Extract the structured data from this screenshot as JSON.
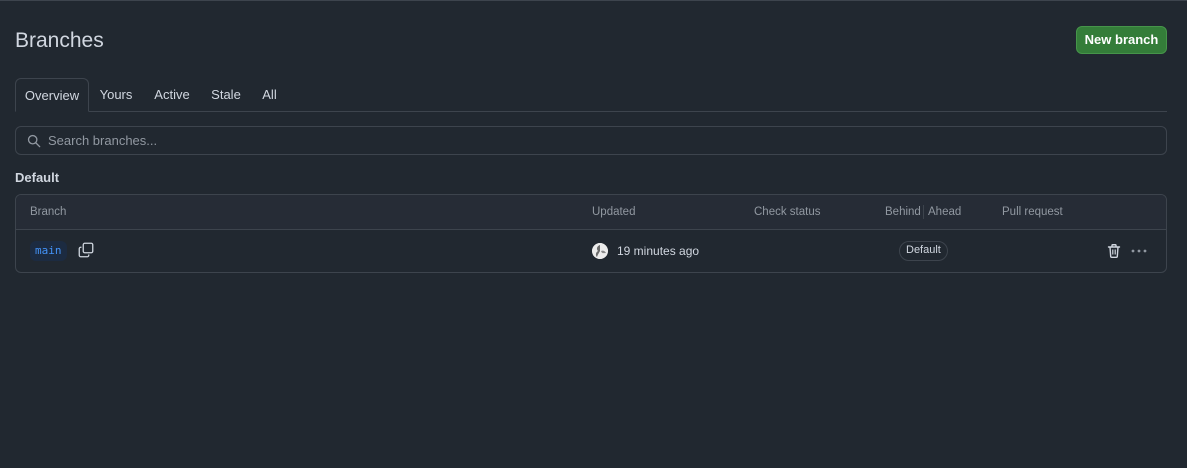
{
  "header": {
    "title": "Branches",
    "new_branch_label": "New branch"
  },
  "tabs": [
    {
      "label": "Overview",
      "selected": true
    },
    {
      "label": "Yours",
      "selected": false
    },
    {
      "label": "Active",
      "selected": false
    },
    {
      "label": "Stale",
      "selected": false
    },
    {
      "label": "All",
      "selected": false
    }
  ],
  "search": {
    "placeholder": "Search branches...",
    "value": "",
    "icon": "search-icon"
  },
  "section": {
    "title": "Default"
  },
  "table": {
    "columns": {
      "branch": "Branch",
      "updated": "Updated",
      "check_status": "Check status",
      "behind": "Behind",
      "ahead": "Ahead",
      "pull_request": "Pull request"
    },
    "rows": [
      {
        "branch": "main",
        "updated": "19 minutes ago",
        "badge": "Default",
        "icons": [
          "copy-icon",
          "avatar",
          "trash-icon",
          "kebab-horizontal-icon"
        ]
      }
    ]
  },
  "colors": {
    "background": "#212830",
    "border": "#3d444d",
    "primary_button": "#347d39",
    "link": "#4493f8",
    "muted_text": "#9198a1"
  }
}
